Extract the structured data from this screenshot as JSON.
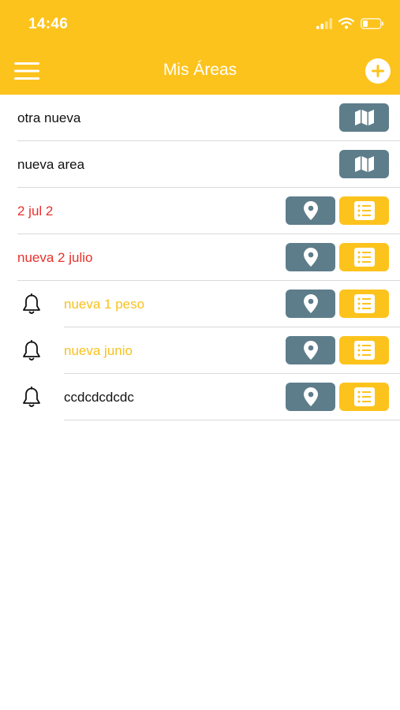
{
  "status_bar": {
    "time": "14:46"
  },
  "header": {
    "title": "Mis Áreas",
    "background": "#FDC31D"
  },
  "colors": {
    "red": "#E8302A",
    "yellow": "#F8C11E",
    "dark": "#111111",
    "gray_button": "#5E7D8B",
    "yellow_button": "#FDC31D"
  },
  "areas": [
    {
      "name": "otra nueva",
      "color": "dark",
      "bell": false,
      "buttons": [
        "map-icon"
      ]
    },
    {
      "name": "nueva area",
      "color": "dark",
      "bell": false,
      "buttons": [
        "map-icon"
      ]
    },
    {
      "name": "2 jul 2",
      "color": "red",
      "bell": false,
      "buttons": [
        "location-pin-icon",
        "list-icon"
      ]
    },
    {
      "name": "nueva 2 julio",
      "color": "red",
      "bell": false,
      "buttons": [
        "location-pin-icon",
        "list-icon"
      ]
    },
    {
      "name": "nueva 1 peso",
      "color": "yellow",
      "bell": true,
      "buttons": [
        "location-pin-icon",
        "list-icon"
      ]
    },
    {
      "name": "nueva junio",
      "color": "yellow",
      "bell": true,
      "buttons": [
        "location-pin-icon",
        "list-icon"
      ]
    },
    {
      "name": "ccdcdcdcdc",
      "color": "dark",
      "bell": true,
      "buttons": [
        "location-pin-icon",
        "list-icon"
      ]
    }
  ]
}
